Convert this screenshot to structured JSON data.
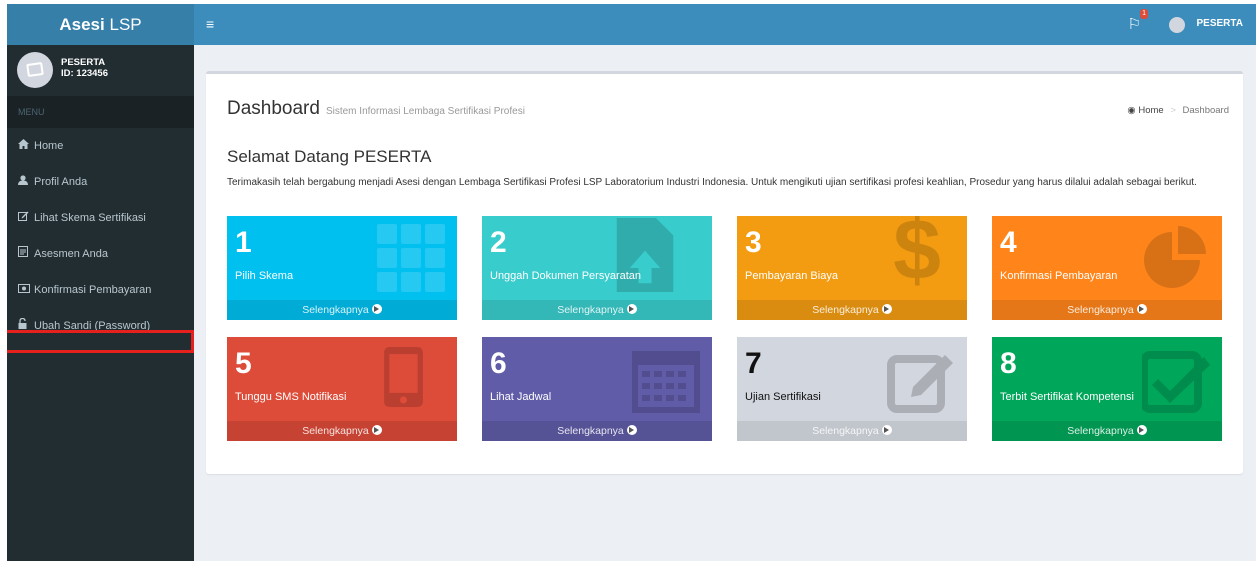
{
  "sidebar": {
    "logo_bold": "Asesi",
    "logo_rest": "LSP",
    "user_name": "PESERTA",
    "user_id": "ID: 123456",
    "menu_header": "MENU",
    "items": [
      {
        "label": "Home",
        "icon": "home-icon"
      },
      {
        "label": "Profil Anda",
        "icon": "user-icon"
      },
      {
        "label": "Lihat Skema Sertifikasi",
        "icon": "edit-icon"
      },
      {
        "label": "Asesmen Anda",
        "icon": "document-icon"
      },
      {
        "label": "Konfirmasi Pembayaran",
        "icon": "money-icon"
      },
      {
        "label": "Ubah Sandi (Password)",
        "icon": "lock-icon"
      }
    ]
  },
  "topbar": {
    "notification_count": "1",
    "user_name": "PESERTA"
  },
  "header": {
    "title": "Dashboard",
    "subtitle": "Sistem Informasi Lembaga Sertifikasi Profesi",
    "breadcrumb_home": "Home",
    "breadcrumb_sep": ">",
    "breadcrumb_current": "Dashboard"
  },
  "main": {
    "welcome": "Selamat Datang PESERTA",
    "intro": "Terimakasih telah bergabung menjadi Asesi dengan Lembaga Sertifikasi Profesi LSP Laboratorium Industri Indonesia. Untuk mengikuti ujian sertifikasi profesi keahlian, Prosedur yang harus dilalui adalah sebagai berikut.",
    "more_label": "Selengkapnya",
    "tiles": [
      {
        "num": "1",
        "label": "Pilih Skema",
        "color": "#00c0ef",
        "icon": "grid-icon"
      },
      {
        "num": "2",
        "label": "Unggah Dokumen Persyaratan",
        "color": "#39cccc",
        "icon": "upload-document-icon"
      },
      {
        "num": "3",
        "label": "Pembayaran Biaya",
        "color": "#f39c12",
        "icon": "dollar-icon"
      },
      {
        "num": "4",
        "label": "Konfirmasi Pembayaran",
        "color": "#ff851b",
        "icon": "pie-chart-icon"
      },
      {
        "num": "5",
        "label": "Tunggu SMS Notifikasi",
        "color": "#dd4b39",
        "icon": "mobile-phone-icon"
      },
      {
        "num": "6",
        "label": "Lihat Jadwal",
        "color": "#605ca8",
        "icon": "calendar-icon"
      },
      {
        "num": "7",
        "label": "Ujian Sertifikasi",
        "color": "#d2d6de",
        "icon": "edit-icon"
      },
      {
        "num": "8",
        "label": "Terbit Sertifikat Kompetensi",
        "color": "#00a65a",
        "icon": "check-square-icon"
      }
    ]
  }
}
